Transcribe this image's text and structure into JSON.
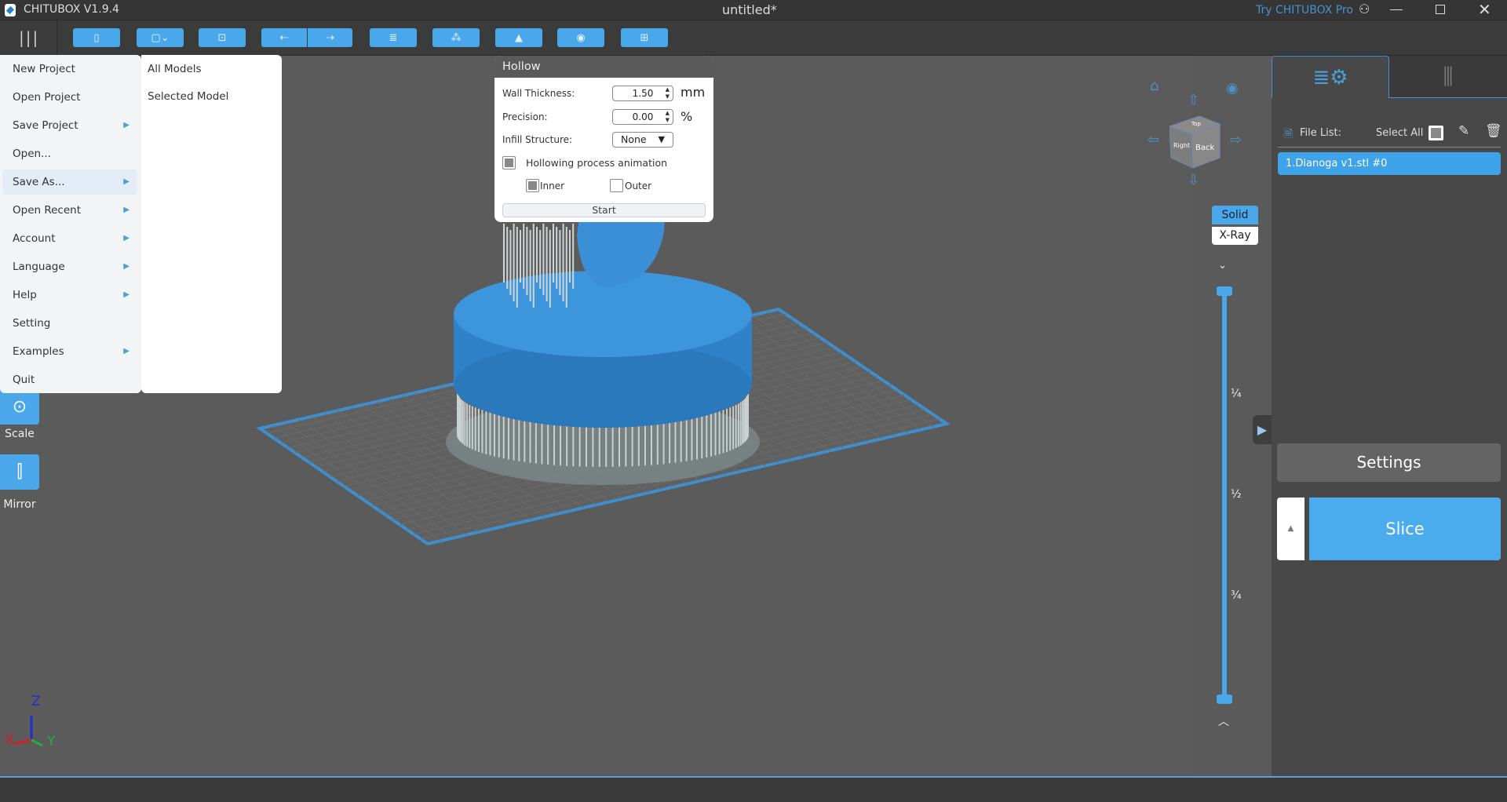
{
  "app": {
    "title": "CHITUBOX V1.9.4",
    "document": "untitled*",
    "promo": "Try CHITUBOX Pro",
    "window_controls": [
      "user-icon",
      "minimize-icon",
      "restore-icon",
      "close-icon"
    ]
  },
  "toolbar": {
    "menu_icon": "hamburger-icon",
    "buttons": [
      {
        "icon": "open-file-icon",
        "glyph": "▯"
      },
      {
        "icon": "save-icon",
        "glyph": "▢⌄"
      },
      {
        "icon": "screenshot-icon",
        "glyph": "⊡"
      },
      {
        "icon": "undo-icon",
        "glyph": "⇠"
      },
      {
        "icon": "redo-icon",
        "glyph": "⇢"
      },
      {
        "icon": "model-list-icon",
        "glyph": "≣"
      },
      {
        "icon": "arrange-icon",
        "glyph": "⁂"
      },
      {
        "icon": "support-icon",
        "glyph": "▲"
      },
      {
        "icon": "hollow-icon",
        "glyph": "◉"
      },
      {
        "icon": "drill-icon",
        "glyph": "⊞"
      }
    ]
  },
  "menu": {
    "items": [
      {
        "label": "New Project",
        "submenu": false
      },
      {
        "label": "Open Project",
        "submenu": false
      },
      {
        "label": "Save Project",
        "submenu": true
      },
      {
        "label": "Open...",
        "submenu": false
      },
      {
        "label": "Save As...",
        "submenu": true,
        "highlighted": true
      },
      {
        "label": "Open Recent",
        "submenu": true
      },
      {
        "label": "Account",
        "submenu": true
      },
      {
        "label": "Language",
        "submenu": true
      },
      {
        "label": "Help",
        "submenu": true
      },
      {
        "label": "Setting",
        "submenu": false
      },
      {
        "label": "Examples",
        "submenu": true
      },
      {
        "label": "Quit",
        "submenu": false
      }
    ],
    "arrow": "▶",
    "submenu_items": [
      "All Models",
      "Selected Model"
    ]
  },
  "side_tools": [
    {
      "label": "Scale",
      "icon": "scale-icon"
    },
    {
      "label": "Mirror",
      "icon": "mirror-icon"
    }
  ],
  "hollow": {
    "title": "Hollow",
    "wall_thickness": {
      "label": "Wall Thickness:",
      "value": "1.50",
      "unit": "mm"
    },
    "precision": {
      "label": "Precision:",
      "value": "0.00",
      "unit": "%"
    },
    "infill": {
      "label": "Infill Structure:",
      "value": "None"
    },
    "animation": {
      "label": "Hollowing process animation",
      "checked": true
    },
    "inner": {
      "label": "Inner",
      "checked": true
    },
    "outer": {
      "label": "Outer",
      "checked": false
    },
    "start": "Start"
  },
  "view": {
    "solid": "Solid",
    "xray": "X-Ray",
    "active": "Solid",
    "cube_faces": [
      "Top",
      "Right",
      "Back"
    ]
  },
  "layer_slider": {
    "marks": [
      "¼",
      "½",
      "¾"
    ],
    "top_value": 1.0,
    "bottom_value": 0.0
  },
  "axes": {
    "x": "X",
    "y": "Y",
    "z": "Z"
  },
  "right_panel": {
    "file_list_label": "File List:",
    "select_all": "Select All",
    "files": [
      {
        "name": "1.Dianoga v1.stl #0",
        "selected": true
      }
    ],
    "settings": "Settings",
    "slice": "Slice"
  },
  "colors": {
    "accent": "#4aa8ea",
    "viewport": "#5b5b5b",
    "panel": "#484848",
    "model": "#3a8fd6"
  }
}
